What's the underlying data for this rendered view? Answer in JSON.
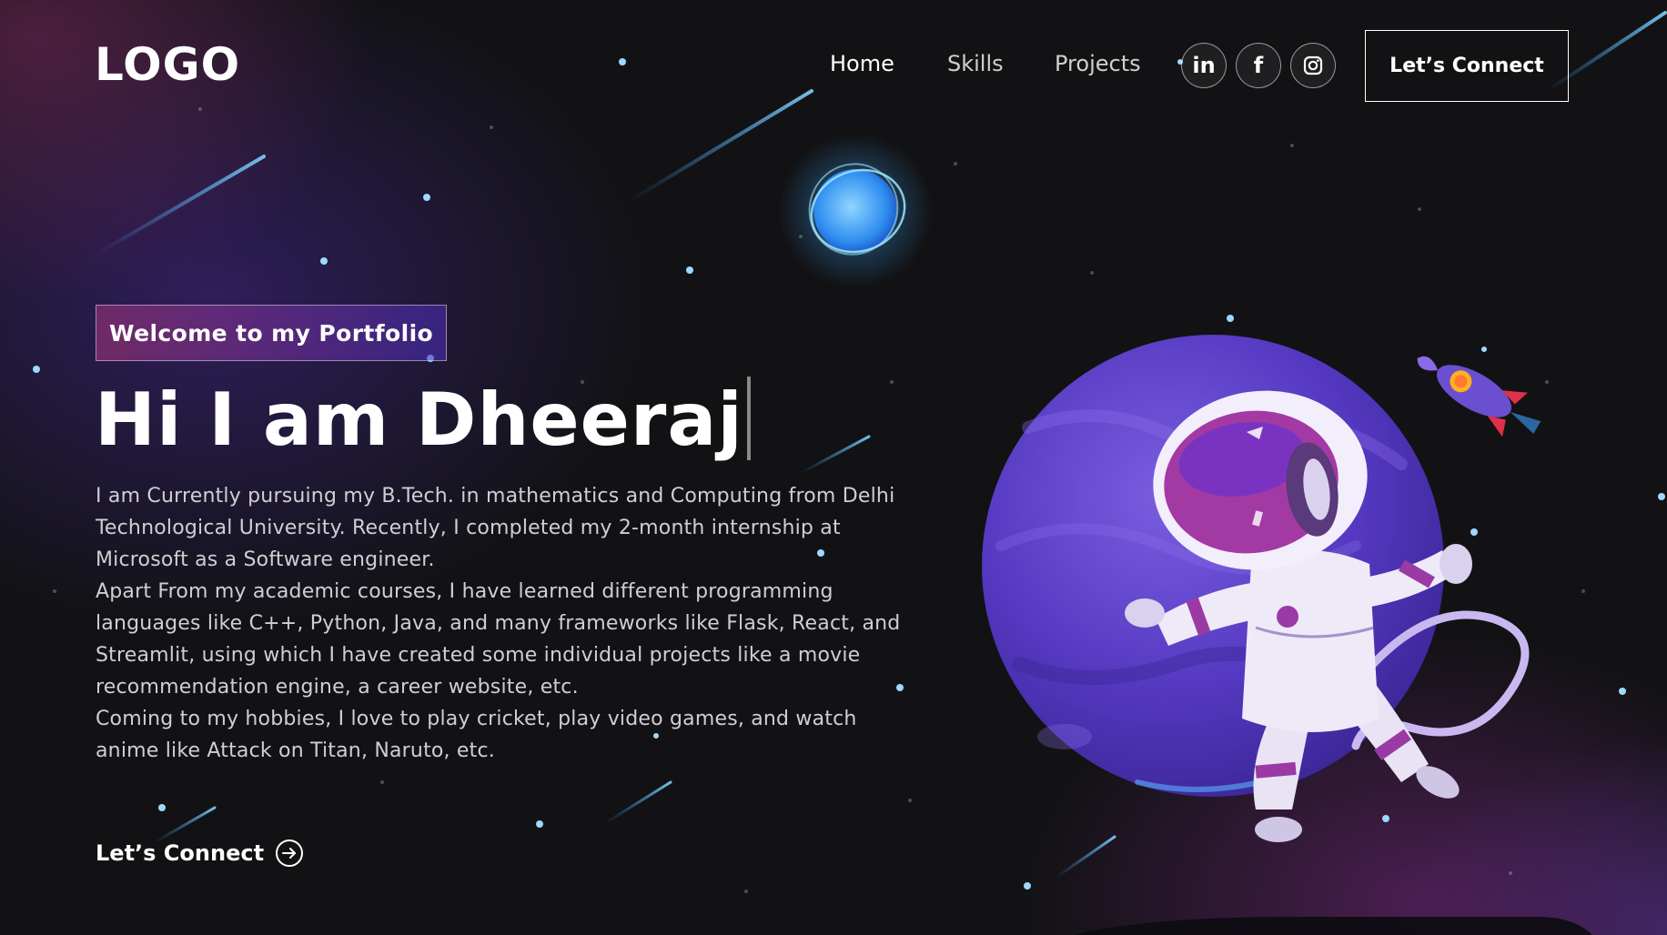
{
  "nav": {
    "logo": "LOGO",
    "links": [
      "Home",
      "Skills",
      "Projects"
    ],
    "social": [
      {
        "name": "linkedin",
        "glyph": "in"
      },
      {
        "name": "facebook",
        "glyph": "f"
      },
      {
        "name": "instagram",
        "glyph": "instagram"
      }
    ],
    "connect_label": "Let’s Connect"
  },
  "hero": {
    "tagline": "Welcome to my Portfolio",
    "title": "Hi I am Dheeraj",
    "bio": [
      "I am Currently pursuing my B.Tech. in mathematics and Computing from Delhi Technological University. Recently, I completed my 2-month internship at Microsoft as a Software engineer.",
      "Apart From my academic courses, I have learned different programming languages like C++, Python, Java, and many frameworks like Flask, React, and Streamlit, using which I have created some individual projects like a movie recommendation engine, a career website, etc.",
      "Coming to my hobbies, I love to play cricket, play video games, and watch anime like Attack on Titan, Naruto, etc."
    ],
    "cta_label": "Let’s Connect"
  },
  "colors": {
    "background": "#121214",
    "accent_pink": "#aa367c",
    "accent_purple": "#4a2fbd",
    "planet": "#5b3fc4",
    "star": "#9fd8ff"
  },
  "icons": [
    "linkedin-icon",
    "facebook-icon",
    "instagram-icon",
    "arrow-right-circle-icon"
  ]
}
